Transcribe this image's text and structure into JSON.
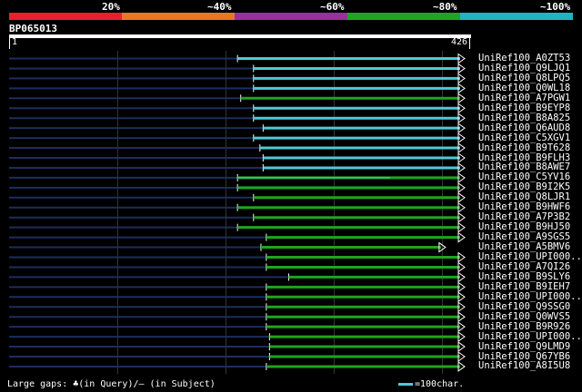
{
  "percent_labels": [
    "20%",
    "~40%",
    "~60%",
    "~80%",
    "~100%"
  ],
  "color_bands": [
    "#e8202e",
    "#e87722",
    "#9b2f9e",
    "#1fa51f",
    "#1fb5c0"
  ],
  "query": {
    "label": "BP065013",
    "ruler_start": "1",
    "ruler_end": "426",
    "length": 426
  },
  "hits": [
    {
      "label": "UniRef100_A0ZT53",
      "start": 214,
      "end": 426,
      "color": "#4fc9d6"
    },
    {
      "label": "UniRef100_Q9LJQ1",
      "start": 229,
      "end": 426,
      "color": "#4fc9d6"
    },
    {
      "label": "UniRef100_Q8LPQ5",
      "start": 229,
      "end": 426,
      "color": "#4fc9d6"
    },
    {
      "label": "UniRef100_Q0WL18",
      "start": 229,
      "end": 426,
      "color": "#4fc9d6"
    },
    {
      "label": "UniRef100_A7PGW1",
      "start": 217,
      "end": 426,
      "color": "#1fa51f"
    },
    {
      "label": "UniRef100_B9EYP8",
      "start": 229,
      "end": 426,
      "color": "#4fc9d6"
    },
    {
      "label": "UniRef100_B8A825",
      "start": 229,
      "end": 426,
      "color": "#4fc9d6"
    },
    {
      "label": "UniRef100_Q6AUD8",
      "start": 238,
      "end": 426,
      "color": "#4fc9d6"
    },
    {
      "label": "UniRef100_C5XGV1",
      "start": 229,
      "end": 426,
      "color": "#4fc9d6"
    },
    {
      "label": "UniRef100_B9T628",
      "start": 235,
      "end": 426,
      "color": "#4fc9d6"
    },
    {
      "label": "UniRef100_B9FLH3",
      "start": 238,
      "end": 426,
      "color": "#4fc9d6"
    },
    {
      "label": "UniRef100_B8AWE7",
      "start": 238,
      "end": 426,
      "color": "#4fc9d6"
    },
    {
      "label": "UniRef100_C5YV16",
      "start": 214,
      "end": 426,
      "color": "#1fa51f",
      "tail": 357
    },
    {
      "label": "UniRef100_B9I2K5",
      "start": 214,
      "end": 426,
      "color": "#1fa51f"
    },
    {
      "label": "UniRef100_Q8LJR1",
      "start": 229,
      "end": 426,
      "color": "#1fa51f"
    },
    {
      "label": "UniRef100_B9HWF6",
      "start": 214,
      "end": 426,
      "color": "#1fa51f"
    },
    {
      "label": "UniRef100_A7P3B2",
      "start": 229,
      "end": 426,
      "color": "#1fa51f"
    },
    {
      "label": "UniRef100_B9HJ50",
      "start": 214,
      "end": 426,
      "color": "#1fa51f"
    },
    {
      "label": "UniRef100_A9SGS5",
      "start": 241,
      "end": 426,
      "color": "#1fa51f"
    },
    {
      "label": "UniRef100_A5BMV6",
      "start": 236,
      "end": 408,
      "color": "#1fa51f"
    },
    {
      "label": "UniRef100_UPI000..",
      "start": 241,
      "end": 426,
      "color": "#1fa51f"
    },
    {
      "label": "UniRef100_A7QI26",
      "start": 241,
      "end": 426,
      "color": "#1fa51f"
    },
    {
      "label": "UniRef100_B9SLY6",
      "start": 262,
      "end": 426,
      "color": "#1fa51f"
    },
    {
      "label": "UniRef100_B9IEH7",
      "start": 241,
      "end": 426,
      "color": "#1fa51f"
    },
    {
      "label": "UniRef100_UPI000..",
      "start": 241,
      "end": 426,
      "color": "#1fa51f"
    },
    {
      "label": "UniRef100_Q9SSG0",
      "start": 241,
      "end": 426,
      "color": "#1fa51f"
    },
    {
      "label": "UniRef100_Q0WVS5",
      "start": 241,
      "end": 426,
      "color": "#1fa51f"
    },
    {
      "label": "UniRef100_B9R926",
      "start": 241,
      "end": 426,
      "color": "#1fa51f"
    },
    {
      "label": "UniRef100_UPI000..",
      "start": 244,
      "end": 426,
      "color": "#1fa51f"
    },
    {
      "label": "UniRef100_Q9LMD9",
      "start": 244,
      "end": 426,
      "color": "#1fa51f"
    },
    {
      "label": "UniRef100_Q67YB6",
      "start": 244,
      "end": 426,
      "color": "#1fa51f"
    },
    {
      "label": "UniRef100_A8I5U8",
      "start": 241,
      "end": 426,
      "color": "#1fa51f"
    }
  ],
  "unaligned_color": "#1c2e5c",
  "footer": {
    "gaps_text": "Large gaps: ♣(in Query)/— (in Subject)",
    "legend_text": "=100char."
  }
}
